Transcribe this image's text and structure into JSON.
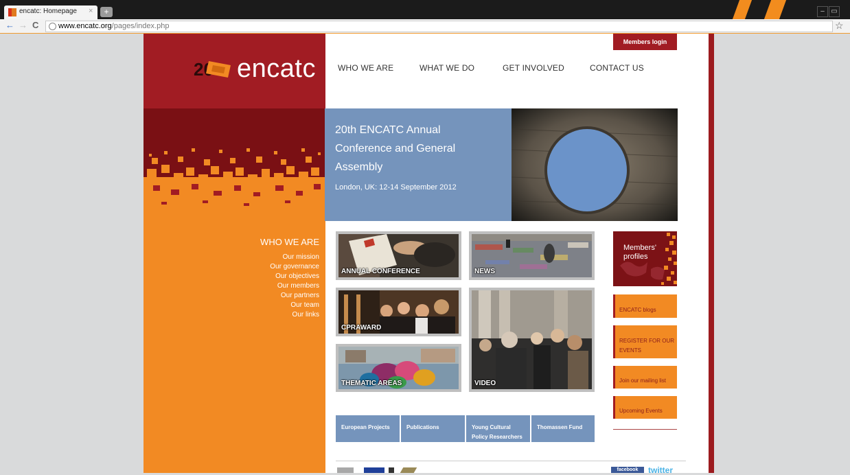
{
  "browser": {
    "tab_title": "encatc: Homepage",
    "tab_close": "×",
    "new_tab": "+",
    "url_domain": "www.encatc.org",
    "url_path": "/pages/index.php",
    "window_controls": [
      "–",
      "▭",
      "×"
    ]
  },
  "header": {
    "logo_text": "encatc",
    "logo_badge_number": "20",
    "members_login": "Members login",
    "nav": [
      "WHO WE ARE",
      "WHAT WE DO",
      "GET INVOLVED",
      "CONTACT US"
    ]
  },
  "banner": {
    "title": "20th ENCATC Annual Conference and General Assembly",
    "subtitle": "London, UK: 12-14 September 2012"
  },
  "sidebar": {
    "heading": "WHO WE ARE",
    "links": [
      "Our mission",
      "Our governance",
      "Our objectives",
      "Our members",
      "Our partners",
      "Our team",
      "Our links"
    ]
  },
  "tiles": {
    "annual": "ANNUAL CONFERENCE",
    "news": "NEWS",
    "cpraward": "CPRAWARD",
    "video": "VIDEO",
    "thematic": "THEMATIC AREAS"
  },
  "right_column": {
    "profiles": "Members' profiles",
    "blogs": "ENCATC blogs",
    "register": "REGISTER FOR OUR EVENTS",
    "mailing": "Join our mailing list",
    "upcoming": "Upcoming Events"
  },
  "bottom_buttons": [
    "European Projects",
    "Publications",
    "Young Cultural Policy Researchers Forum",
    "Thomassen Fund"
  ],
  "footer": {
    "facebook": "facebook",
    "twitter": "twitter"
  },
  "colors": {
    "brand_red": "#a11c23",
    "brand_orange": "#f28a23",
    "banner_blue": "#7594bc"
  }
}
